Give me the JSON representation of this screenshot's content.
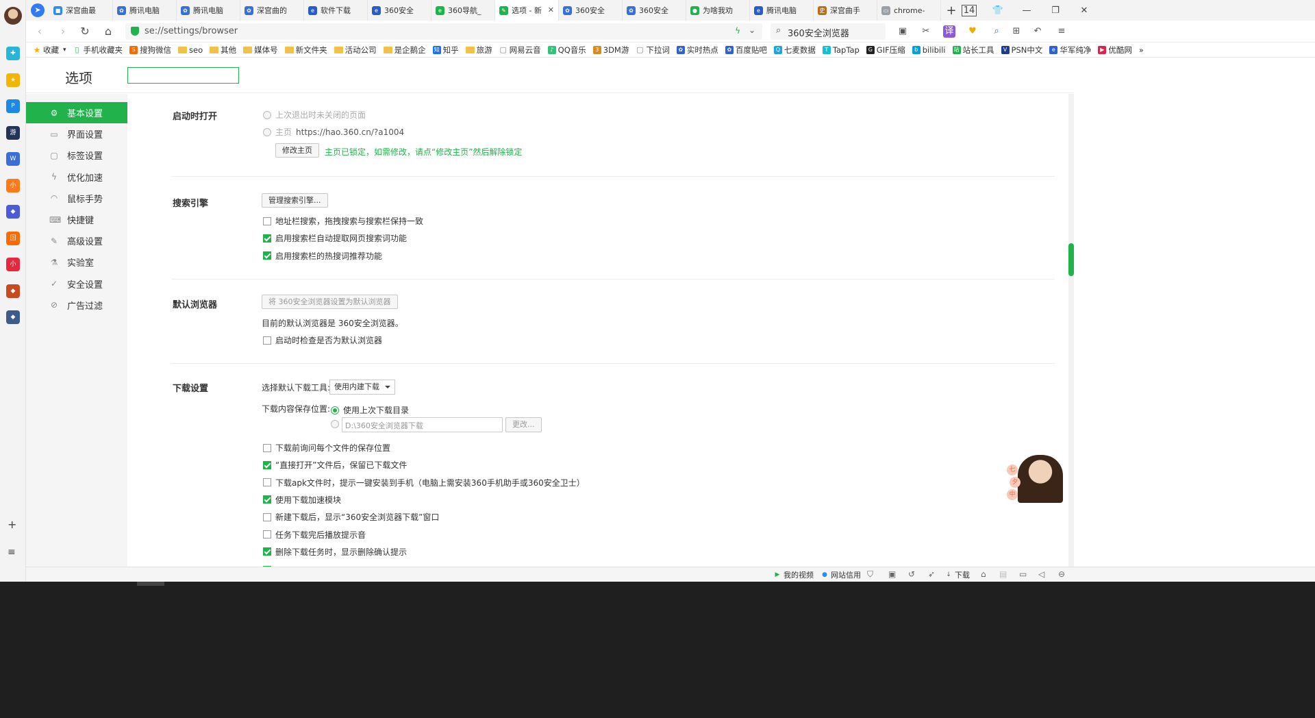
{
  "rail": {
    "apps": [
      {
        "name": "app-plus",
        "color": "#2ab4d8",
        "glyph": "✚"
      },
      {
        "name": "app-favorites",
        "color": "#f4b400",
        "glyph": "★"
      },
      {
        "name": "app-p",
        "color": "#1e88e5",
        "glyph": "P"
      },
      {
        "name": "app-game",
        "color": "#243457",
        "glyph": "游"
      },
      {
        "name": "app-doc",
        "color": "#3b6fd6",
        "glyph": "W"
      },
      {
        "name": "app-novel",
        "color": "#ff7a1a",
        "glyph": "小"
      },
      {
        "name": "app-game2",
        "color": "#4a5cd8",
        "glyph": "◆"
      },
      {
        "name": "app-orange",
        "color": "#ff6a00",
        "glyph": "回"
      },
      {
        "name": "app-red",
        "color": "#e7273d",
        "glyph": "小"
      },
      {
        "name": "app-game3",
        "color": "#c84b1e",
        "glyph": "◆"
      },
      {
        "name": "app-game4",
        "color": "#3d5c8a",
        "glyph": "◆"
      }
    ]
  },
  "tabs": [
    {
      "label": "深宫曲最",
      "fav_color": "#2d8cf0",
      "fav": "■"
    },
    {
      "label": "腾讯电脑",
      "fav_color": "#3a6fd8",
      "fav": "✿"
    },
    {
      "label": "腾讯电脑",
      "fav_color": "#3a6fd8",
      "fav": "✿"
    },
    {
      "label": "深宫曲的",
      "fav_color": "#3a6fd8",
      "fav": "✿"
    },
    {
      "label": "软件下载",
      "fav_color": "#2a5cc6",
      "fav": "e"
    },
    {
      "label": "360安全",
      "fav_color": "#2a5cc6",
      "fav": "e"
    },
    {
      "label": "360导航_",
      "fav_color": "#22b24c",
      "fav": "e"
    },
    {
      "label": "选项 - 新",
      "fav_color": "#22b24c",
      "fav": "✎",
      "active": true
    },
    {
      "label": "360安全",
      "fav_color": "#3a6fd8",
      "fav": "✿"
    },
    {
      "label": "360安全",
      "fav_color": "#3a6fd8",
      "fav": "✿"
    },
    {
      "label": "为啥我劝",
      "fav_color": "#22b24c",
      "fav": "●"
    },
    {
      "label": "腾讯电脑",
      "fav_color": "#2a5cc6",
      "fav": "e"
    },
    {
      "label": "深宫曲手",
      "fav_color": "#b86f1c",
      "fav": "史"
    },
    {
      "label": "chrome-",
      "fav_color": "#9aa0a6",
      "fav": "▭"
    }
  ],
  "tab_count": "14",
  "address": {
    "url": "se://settings/browser",
    "search_text": "360安全浏览器"
  },
  "bookmarks": [
    {
      "label": "收藏",
      "type": "star"
    },
    {
      "label": "手机收藏夹",
      "type": "phone"
    },
    {
      "label": "搜狗微信",
      "type": "icon",
      "color": "#ff6a00",
      "glyph": "S"
    },
    {
      "label": "seo",
      "type": "folder"
    },
    {
      "label": "其他",
      "type": "folder"
    },
    {
      "label": "媒体号",
      "type": "folder"
    },
    {
      "label": "新文件夹",
      "type": "folder"
    },
    {
      "label": "活动公司",
      "type": "folder"
    },
    {
      "label": "是企鹅企",
      "type": "folder"
    },
    {
      "label": "知乎",
      "type": "icon",
      "color": "#1772f6",
      "glyph": "知"
    },
    {
      "label": "旅游",
      "type": "folder"
    },
    {
      "label": "网易云音",
      "type": "page"
    },
    {
      "label": "QQ音乐",
      "type": "icon",
      "color": "#31c27c",
      "glyph": "♪"
    },
    {
      "label": "3DM游",
      "type": "icon",
      "color": "#d88b1e",
      "glyph": "3"
    },
    {
      "label": "下拉词",
      "type": "page"
    },
    {
      "label": "实时热点",
      "type": "icon",
      "color": "#2d61d6",
      "glyph": "✿"
    },
    {
      "label": "百度贴吧",
      "type": "icon",
      "color": "#2d61d6",
      "glyph": "✿"
    },
    {
      "label": "七麦数据",
      "type": "icon",
      "color": "#1fa3e0",
      "glyph": "Q"
    },
    {
      "label": "TapTap",
      "type": "icon",
      "color": "#14c0d4",
      "glyph": "T"
    },
    {
      "label": "GIF压缩",
      "type": "icon",
      "color": "#222222",
      "glyph": "G"
    },
    {
      "label": "bilibili",
      "type": "icon",
      "color": "#00a1d6",
      "glyph": "b"
    },
    {
      "label": "站长工具",
      "type": "icon",
      "color": "#22b24c",
      "glyph": "站"
    },
    {
      "label": "PSN中文",
      "type": "icon",
      "color": "#1d3d8f",
      "glyph": "V"
    },
    {
      "label": "华军纯净",
      "type": "icon",
      "color": "#2d61d6",
      "glyph": "e"
    },
    {
      "label": "优酷网",
      "type": "icon",
      "color": "#e0224b",
      "glyph": "▶"
    }
  ],
  "settings": {
    "title": "选项",
    "search_value": ""
  },
  "sidebar": {
    "items": [
      {
        "label": "基本设置",
        "icon": "gear-icon",
        "glyph": "⚙",
        "active": true
      },
      {
        "label": "界面设置",
        "icon": "window-icon",
        "glyph": "▭"
      },
      {
        "label": "标签设置",
        "icon": "tab-icon",
        "glyph": "▢"
      },
      {
        "label": "优化加速",
        "icon": "bolt-icon",
        "glyph": "ϟ"
      },
      {
        "label": "鼠标手势",
        "icon": "mouse-icon",
        "glyph": "◠"
      },
      {
        "label": "快捷键",
        "icon": "keyboard-icon",
        "glyph": "⌨"
      },
      {
        "label": "高级设置",
        "icon": "wrench-icon",
        "glyph": "✎"
      },
      {
        "label": "实验室",
        "icon": "flask-icon",
        "glyph": "⚗"
      },
      {
        "label": "安全设置",
        "icon": "shield-icon",
        "glyph": "✓"
      },
      {
        "label": "广告过滤",
        "icon": "block-icon",
        "glyph": "⊘"
      }
    ]
  },
  "startup": {
    "title": "启动时打开",
    "opt_restore": "上次退出时未关闭的页面",
    "opt_home_label": "主页",
    "opt_home_url": "https://hao.360.cn/?a1004",
    "change_home_btn": "修改主页",
    "locked_note": "主页已锁定，如需修改，请点“修改主页”然后解除锁定"
  },
  "search_engine": {
    "title": "搜索引擎",
    "manage_btn": "管理搜索引擎...",
    "opts": [
      {
        "label": "地址栏搜索，拖拽搜索与搜索栏保持一致",
        "checked": false
      },
      {
        "label": "启用搜索栏自动提取网页搜索词功能",
        "checked": true
      },
      {
        "label": "启用搜索栏的热搜词推荐功能",
        "checked": true
      }
    ]
  },
  "default_browser": {
    "title": "默认浏览器",
    "set_btn": "将 360安全浏览器设置为默认浏览器",
    "current": "目前的默认浏览器是 360安全浏览器。",
    "check_opt": "启动时检查是否为默认浏览器"
  },
  "download": {
    "title": "下载设置",
    "tool_label": "选择默认下载工具:",
    "tool_value": "使用内建下载",
    "location_label": "下载内容保存位置:",
    "loc_last": "使用上次下载目录",
    "loc_path": "D:\\360安全浏览器下载",
    "change_btn": "更改...",
    "opts": [
      {
        "label": "下载前询问每个文件的保存位置",
        "checked": false
      },
      {
        "label": "“直接打开”文件后，保留已下载文件",
        "checked": true
      },
      {
        "label": "下载apk文件时，提示一键安装到手机（电脑上需安装360手机助手或360安全卫士）",
        "checked": false
      },
      {
        "label": "使用下载加速模块",
        "checked": true
      },
      {
        "label": "新建下载后，显示“360安全浏览器下载”窗口",
        "checked": false
      },
      {
        "label": "任务下载完后播放提示音",
        "checked": false
      },
      {
        "label": "删除下载任务时，显示删除确认提示",
        "checked": true
      }
    ]
  },
  "statusbar": {
    "my_video": "我的视频",
    "credit": "网站信用",
    "download": "下载"
  },
  "float_avatar": {
    "bubbles": [
      "七",
      "夕",
      "中"
    ]
  }
}
